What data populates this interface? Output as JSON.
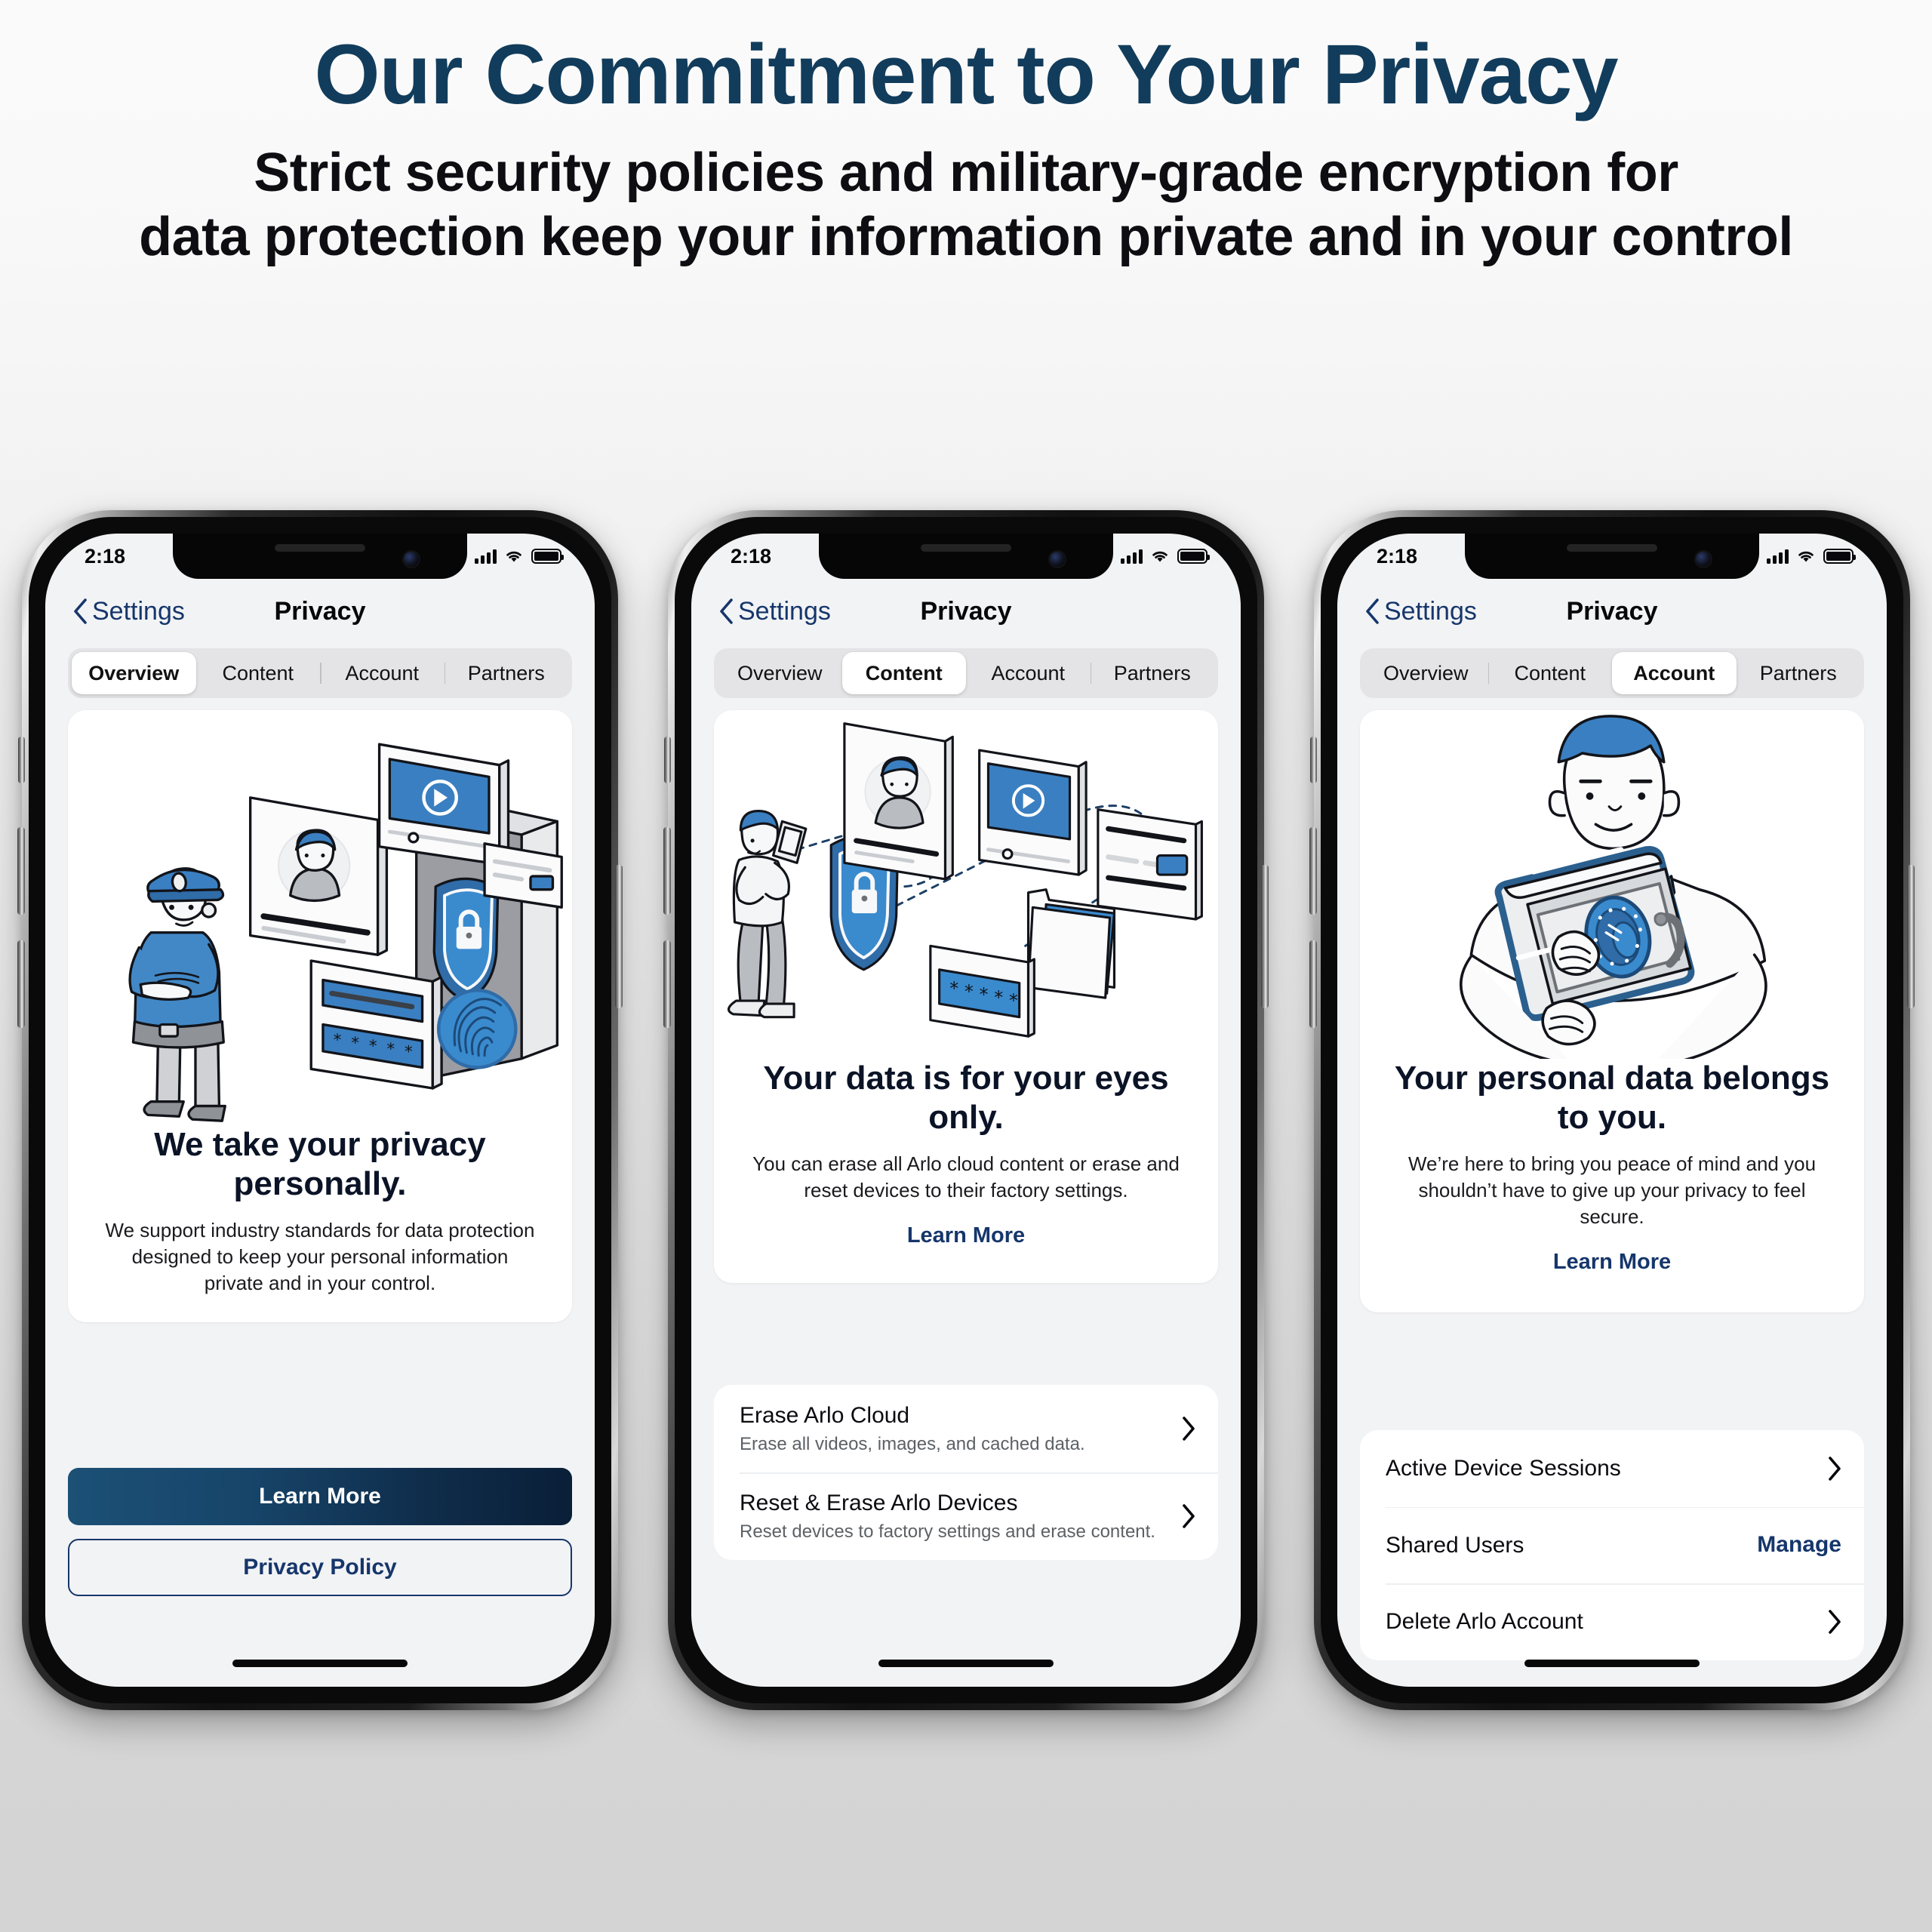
{
  "hero": {
    "title": "Our Commitment to Your Privacy",
    "subtitle_line1": "Strict security policies and military-grade encryption for",
    "subtitle_line2": "data protection keep your information private and in your control",
    "title_color": "#123c5b"
  },
  "colors": {
    "accent_navy": "#16366b",
    "illustration_blue": "#3a82c4",
    "button_gradient_start": "#1c5075",
    "button_gradient_end": "#0a1f38",
    "screen_background": "#f2f3f5"
  },
  "statusbar": {
    "time": "2:18",
    "signal_icon": "cellular-signal-icon",
    "wifi_icon": "wifi-icon",
    "battery_icon": "battery-icon"
  },
  "navbar": {
    "back_label": "Settings",
    "back_icon": "chevron-left-icon",
    "title": "Privacy"
  },
  "tabs": [
    "Overview",
    "Content",
    "Account",
    "Partners"
  ],
  "phones": [
    {
      "id": "overview",
      "active_tab": "Overview",
      "active_tab_index": 0,
      "illustration": "security-guard-data-illustration",
      "heading": "We take your privacy personally.",
      "body": "We support industry standards for data protection designed to keep your personal information private and in your control.",
      "buttons": [
        {
          "label": "Learn More",
          "style": "primary"
        },
        {
          "label": "Privacy Policy",
          "style": "outline"
        }
      ],
      "list": []
    },
    {
      "id": "content",
      "active_tab": "Content",
      "active_tab_index": 1,
      "illustration": "person-phone-shield-data-illustration",
      "heading": "Your data is for your eyes only.",
      "body": "You can erase all Arlo cloud content or erase and reset devices to their factory settings.",
      "link": "Learn More",
      "list": [
        {
          "title": "Erase Arlo Cloud",
          "subtitle": "Erase all videos, images, and cached data.",
          "accessory": "chevron-right-icon"
        },
        {
          "title": "Reset & Erase Arlo Devices",
          "subtitle": "Reset devices to factory settings and erase content.",
          "accessory": "chevron-right-icon"
        }
      ]
    },
    {
      "id": "account",
      "active_tab": "Account",
      "active_tab_index": 2,
      "illustration": "person-hugging-safe-illustration",
      "heading": "Your personal data belongs to you.",
      "body": "We’re here to bring you peace of mind and you shouldn’t have to give up your privacy to feel secure.",
      "link": "Learn More",
      "list": [
        {
          "title": "Active Device Sessions",
          "subtitle": "",
          "accessory": "chevron-right-icon"
        },
        {
          "title": "Shared Users",
          "subtitle": "",
          "accessory": "text",
          "action_label": "Manage"
        },
        {
          "title": "Delete Arlo Account",
          "subtitle": "",
          "accessory": "chevron-right-icon"
        }
      ]
    }
  ]
}
